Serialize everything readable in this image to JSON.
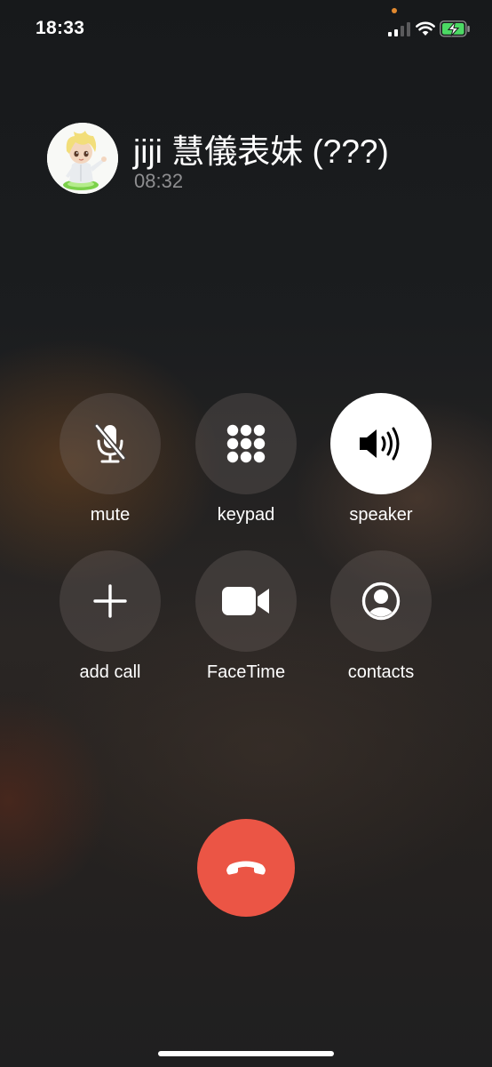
{
  "status_bar": {
    "time": "18:33",
    "privacy_dot_color": "#e2892f",
    "battery_fill_color": "#4cd964",
    "battery_charging": true
  },
  "caller": {
    "name": "jiji 慧儀表妹 (???)",
    "duration": "08:32"
  },
  "controls": [
    {
      "id": "mute",
      "label": "mute",
      "icon": "mute-microphone-icon",
      "active": false
    },
    {
      "id": "keypad",
      "label": "keypad",
      "icon": "keypad-icon",
      "active": false
    },
    {
      "id": "speaker",
      "label": "speaker",
      "icon": "speaker-icon",
      "active": true
    },
    {
      "id": "add_call",
      "label": "add call",
      "icon": "plus-icon",
      "active": false
    },
    {
      "id": "facetime",
      "label": "FaceTime",
      "icon": "video-camera-icon",
      "active": false
    },
    {
      "id": "contacts",
      "label": "contacts",
      "icon": "person-circle-icon",
      "active": false
    }
  ],
  "end_call": {
    "icon": "phone-hangup-icon",
    "color": "#eb5545"
  }
}
